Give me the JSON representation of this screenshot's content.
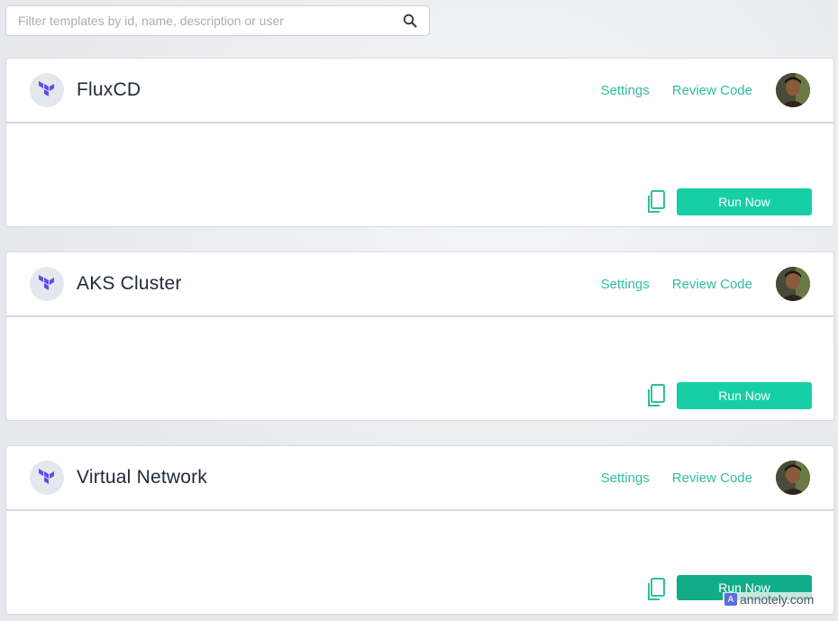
{
  "search": {
    "placeholder": "Filter templates by id, name, description or user",
    "value": ""
  },
  "templates": [
    {
      "title": "FluxCD",
      "settings_label": "Settings",
      "review_label": "Review Code",
      "run_label": "Run Now"
    },
    {
      "title": "AKS Cluster",
      "settings_label": "Settings",
      "review_label": "Review Code",
      "run_label": "Run Now"
    },
    {
      "title": "Virtual Network",
      "settings_label": "Settings",
      "review_label": "Review Code",
      "run_label": "Run Now"
    }
  ],
  "watermark": {
    "mark": "A",
    "text": "annotely.com"
  },
  "colors": {
    "accent": "#2fbf9a",
    "button": "#17cfa6",
    "logo": "#5c4ee5"
  }
}
